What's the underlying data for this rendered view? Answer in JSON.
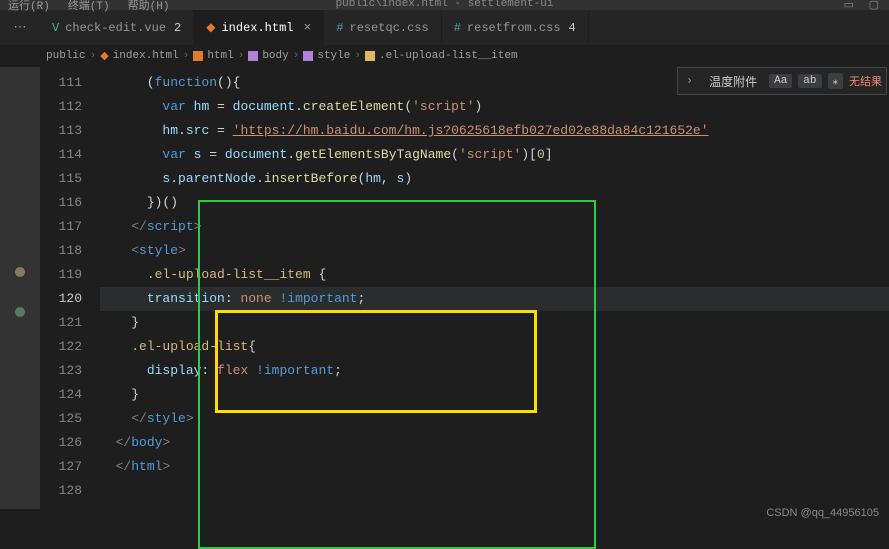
{
  "window": {
    "title": "public\\index.html - settlement-ui"
  },
  "menubar": {
    "items": [
      "运行(R)",
      "终端(T)",
      "帮助(H)"
    ]
  },
  "tabs": [
    {
      "icon": "vue",
      "label": "check-edit.vue",
      "badge": "2",
      "active": false,
      "close": ""
    },
    {
      "icon": "html",
      "label": "index.html",
      "badge": "",
      "active": true,
      "close": "×"
    },
    {
      "icon": "css",
      "label": "resetqc.css",
      "badge": "",
      "active": false,
      "close": ""
    },
    {
      "icon": "css",
      "label": "resetfrom.css",
      "badge": "4",
      "active": false,
      "close": ""
    }
  ],
  "breadcrumbs": [
    {
      "label": "public",
      "icon": ""
    },
    {
      "label": "index.html",
      "icon": "html"
    },
    {
      "label": "html",
      "icon": "cube-orange"
    },
    {
      "label": "body",
      "icon": "cube-purple"
    },
    {
      "label": "style",
      "icon": "cube-purple"
    },
    {
      "label": ".el-upload-list__item",
      "icon": "cube-yellow"
    }
  ],
  "find": {
    "toggle": "›",
    "input": "温度附件",
    "btns": [
      "Aa",
      "ab",
      "⁎"
    ],
    "results": "无结果"
  },
  "gutter_start": 111,
  "current_line": 120,
  "code": {
    "l111": {
      "pre": "        ",
      "kw": "var",
      "sp": " ",
      "v1": "hm",
      "eq": " = ",
      "obj": "document",
      "dot": ".",
      "fn": "createElement",
      "op": "(",
      "str": "'script'",
      "cl": ")"
    },
    "l112": {
      "pre": "        ",
      "v1": "hm",
      "dot": ".",
      "v2": "src",
      "eq": " = ",
      "str": "'https://hm.baidu.com/hm.js?0625618efb027ed02e88da84c121652e'"
    },
    "l113": {
      "pre": "        ",
      "kw": "var",
      "sp": " ",
      "v1": "s",
      "eq": " = ",
      "obj": "document",
      "dot": ".",
      "fn": "getElementsByTagName",
      "op": "(",
      "str": "'script'",
      "cl": ")[",
      "num": "0",
      "cl2": "]"
    },
    "l114": {
      "pre": "        ",
      "v1": "s",
      "dot": ".",
      "v2": "parentNode",
      "dot2": ".",
      "fn": "insertBefore",
      "op": "(",
      "a1": "hm",
      "c": ", ",
      "a2": "s",
      "cl": ")"
    },
    "l115": {
      "pre": "      ",
      "p": "})()"
    },
    "l116": {
      "pre": "    ",
      "open": "</",
      "tag": "script",
      "close": ">"
    },
    "l117": {
      "pre": "    ",
      "open": "<",
      "tag": "style",
      "close": ">"
    },
    "l118": {
      "pre": "      ",
      "sel": ".el-upload-list__item",
      "sp": " ",
      "br": "{"
    },
    "l119": {
      "pre": "      ",
      "prop": "transition",
      "col": ": ",
      "val": "none",
      "sp": " ",
      "imp": "!important",
      "sc": ";"
    },
    "l120": {
      "pre": "    ",
      "br": "}"
    },
    "l121": {
      "pre": "    ",
      "sel": ".el-upload-list",
      "br": "{"
    },
    "l122": {
      "pre": "      ",
      "prop": "display",
      "col": ": ",
      "val": "flex",
      "sp": " ",
      "imp": "!important",
      "sc": ";"
    },
    "l123": {
      "pre": "    ",
      "br": "}"
    },
    "l124": {
      "pre": "    ",
      "open": "</",
      "tag": "style",
      "close": ">"
    },
    "l125": {
      "pre": "  ",
      "open": "</",
      "tag": "body",
      "close": ">"
    },
    "l126": {
      "pre": "  ",
      "open": "</",
      "tag": "html",
      "close": ">"
    }
  },
  "watermark": "CSDN @qq_44956105"
}
